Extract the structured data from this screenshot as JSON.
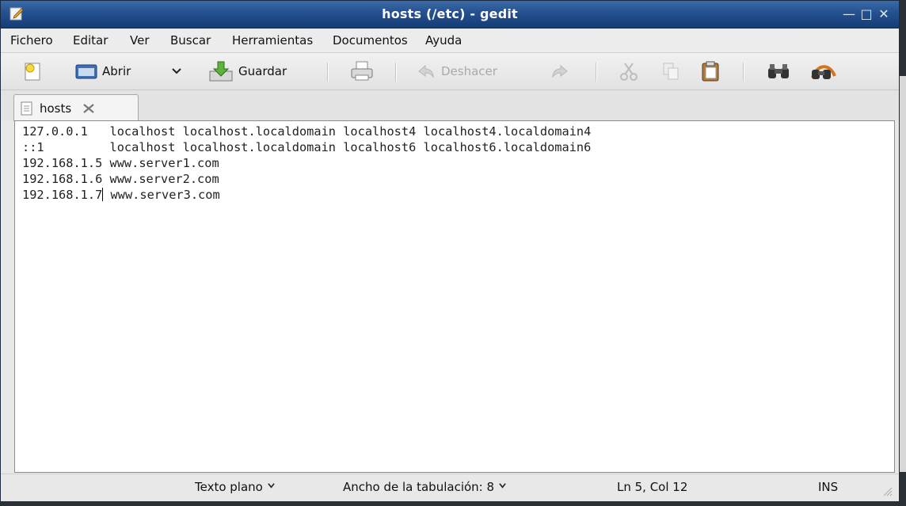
{
  "window": {
    "title": "hosts (/etc) - gedit"
  },
  "menu": [
    "Fichero",
    "Editar",
    "Ver",
    "Buscar",
    "Herramientas",
    "Documentos",
    "Ayuda"
  ],
  "toolbar": {
    "open_label": "Abrir",
    "save_label": "Guardar",
    "undo_label": "Deshacer"
  },
  "tab": {
    "label": "hosts"
  },
  "editor": {
    "lines": [
      "127.0.0.1   localhost localhost.localdomain localhost4 localhost4.localdomain4",
      "::1         localhost localhost.localdomain localhost6 localhost6.localdomain6",
      "192.168.1.5 www.server1.com",
      "192.168.1.6 www.server2.com",
      "192.168.1.7 www.server3.com"
    ],
    "cursor_line": 5,
    "cursor_col": 12
  },
  "status": {
    "syntax": "Texto plano",
    "tab_width": "Ancho de la tabulación:  8",
    "position": "Ln 5, Col 12",
    "mode": "INS"
  }
}
